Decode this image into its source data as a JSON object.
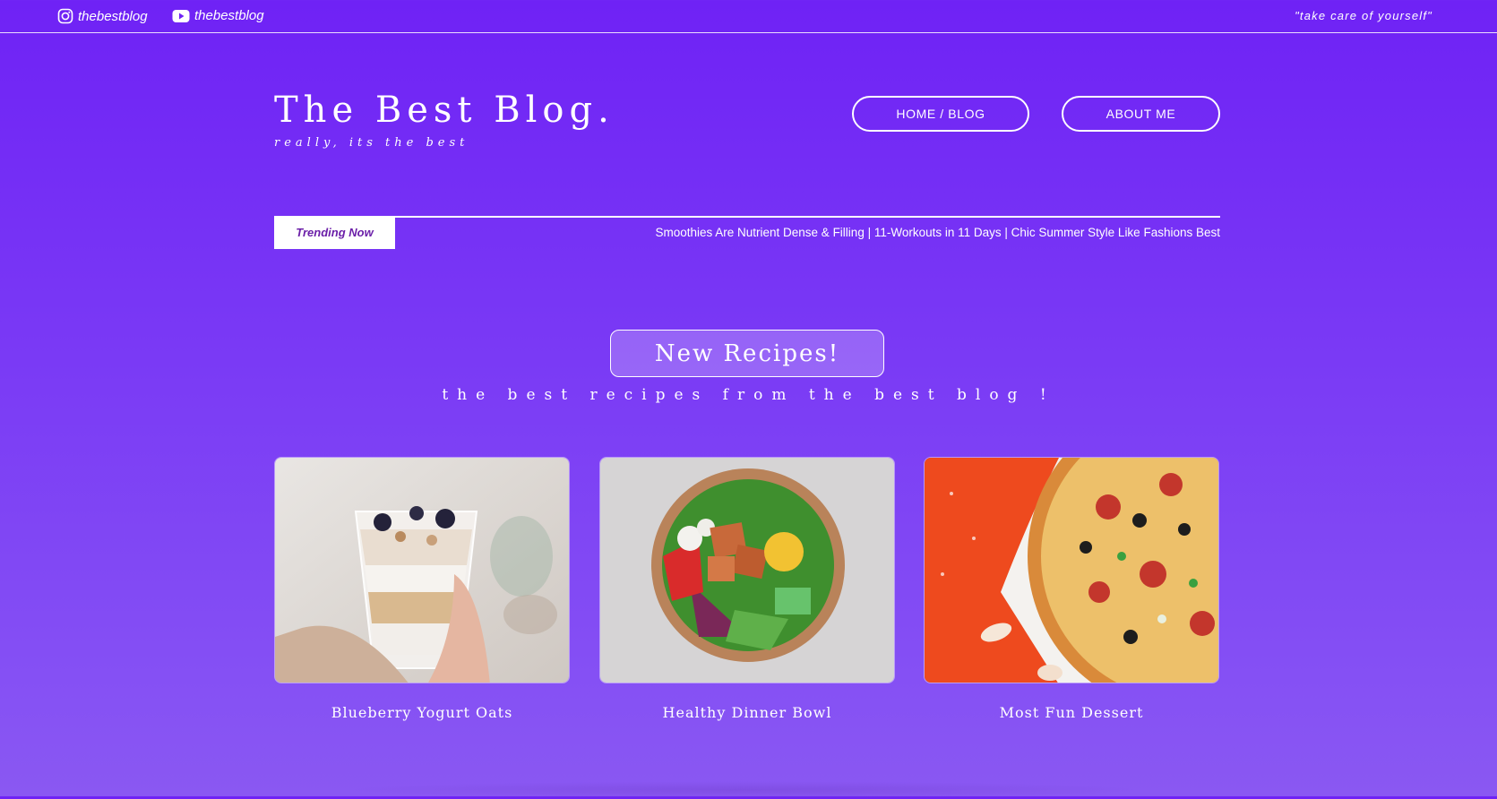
{
  "topbar": {
    "instagram_handle": "thebestblog",
    "youtube_handle": "thebestblog",
    "quote": "\"take care of yourself\""
  },
  "brand": {
    "title": "The Best Blog.",
    "tagline": "really, its the best"
  },
  "nav": {
    "home_label": "HOME / BLOG",
    "about_label": "ABOUT ME"
  },
  "trending": {
    "badge": "Trending Now",
    "headlines": "Smoothies Are Nutrient Dense & Filling | 11-Workouts in 11 Days | Chic Summer Style Like Fashions Best"
  },
  "section": {
    "button": "New Recipes!",
    "subtitle": "the best recipes from the best blog !"
  },
  "recipes": [
    {
      "title": "Blueberry Yogurt Oats",
      "image": "yogurt-parfait-photo"
    },
    {
      "title": "Healthy Dinner Bowl",
      "image": "salad-bowl-photo"
    },
    {
      "title": "Most Fun Dessert",
      "image": "pizza-photo"
    }
  ],
  "colors": {
    "background_top": "#6f22f5",
    "background_bottom": "#8a58f2",
    "badge_text": "#6b1fa8"
  }
}
